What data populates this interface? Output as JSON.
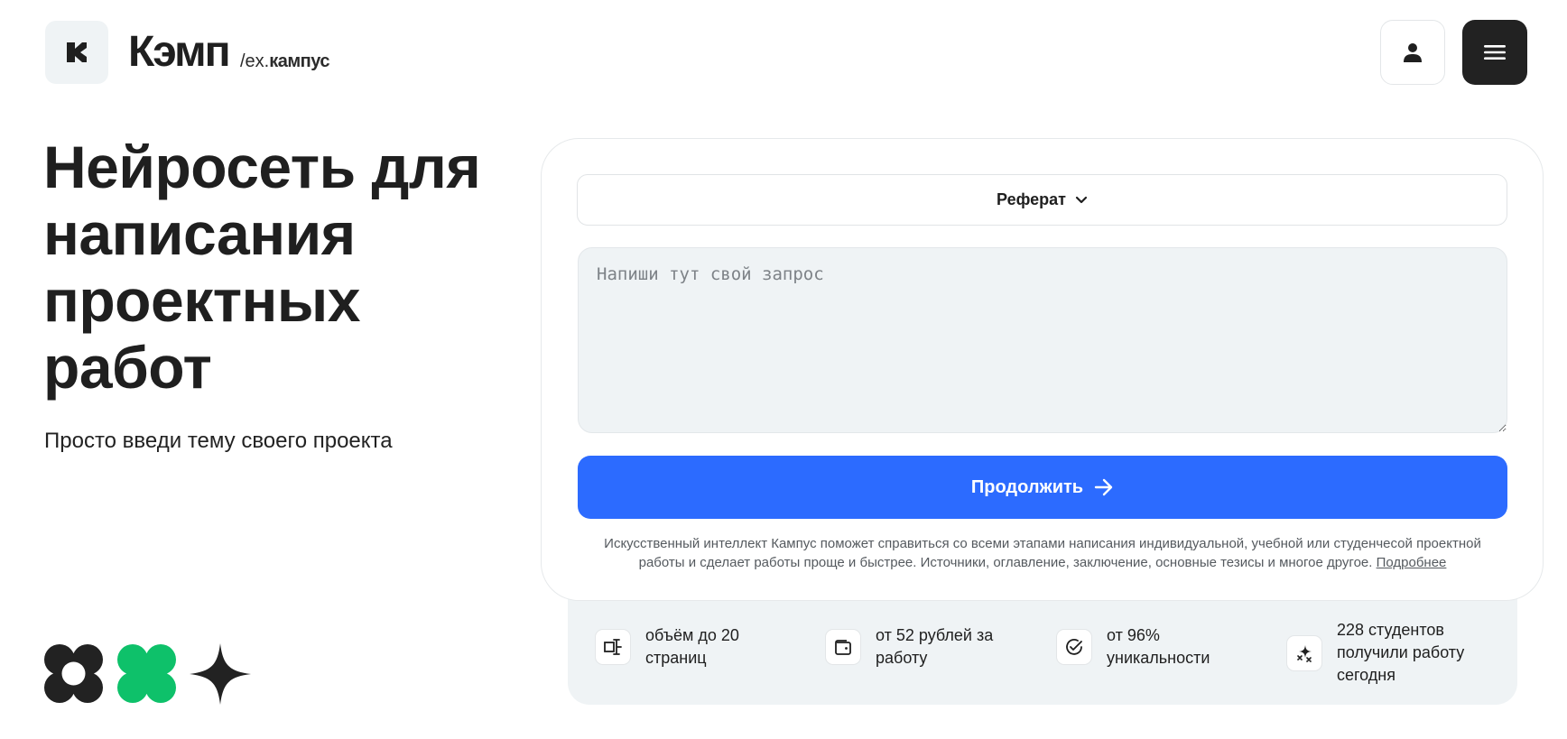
{
  "header": {
    "brand": "Кэмп",
    "brand_sub_prefix": "/ex.",
    "brand_sub_name": "кампус",
    "logo_icon": "k-logo-icon",
    "profile_icon": "user-icon",
    "menu_icon": "hamburger-icon"
  },
  "hero": {
    "title": "Нейросеть для написания проектных работ",
    "subtitle": "Просто введи тему своего проекта"
  },
  "form": {
    "work_type": "Реферат",
    "prompt_placeholder": "Напиши тут свой запрос",
    "continue_label": "Продолжить",
    "note": "Искусственный интеллект Кампус поможет справиться со всеми этапами написания индивидуальной, учебной или студенчесой проектной работы и сделает работы проще и быстрее. Источники, оглавление, заключение, основные тезисы и многое другое.",
    "more_link": "Подробнее"
  },
  "features": [
    {
      "icon": "pages-icon",
      "text": "объём до 20 страниц"
    },
    {
      "icon": "wallet-icon",
      "text": "от 52 рублей за работу"
    },
    {
      "icon": "check-circle-icon",
      "text": "от 96% уникальности"
    },
    {
      "icon": "sparkles-icon",
      "text": "228 студентов получили работу сегодня"
    }
  ],
  "colors": {
    "accent": "#2c6bff",
    "dark": "#222222",
    "green": "#0ec16a",
    "panel": "#eff3f5"
  }
}
